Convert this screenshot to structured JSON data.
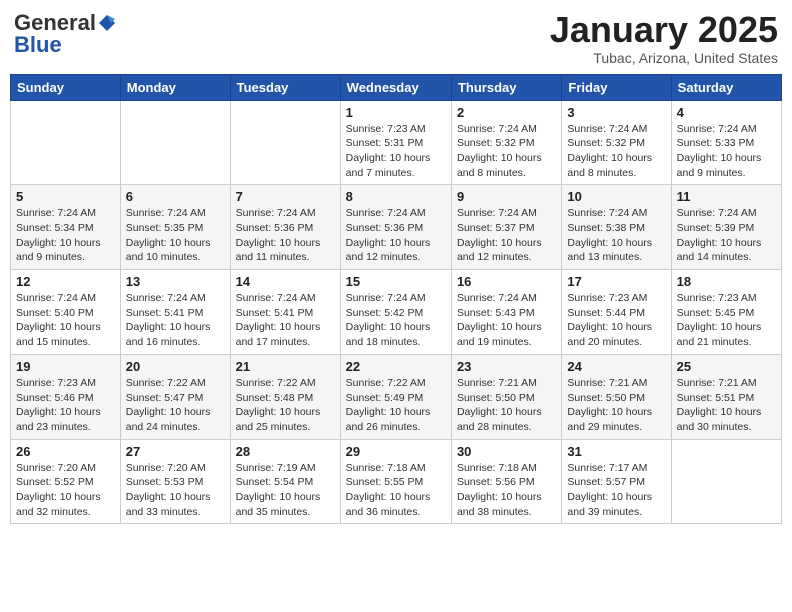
{
  "header": {
    "logo_general": "General",
    "logo_blue": "Blue",
    "title": "January 2025",
    "subtitle": "Tubac, Arizona, United States"
  },
  "weekdays": [
    "Sunday",
    "Monday",
    "Tuesday",
    "Wednesday",
    "Thursday",
    "Friday",
    "Saturday"
  ],
  "weeks": [
    [
      {
        "day": "",
        "info": ""
      },
      {
        "day": "",
        "info": ""
      },
      {
        "day": "",
        "info": ""
      },
      {
        "day": "1",
        "info": "Sunrise: 7:23 AM\nSunset: 5:31 PM\nDaylight: 10 hours\nand 7 minutes."
      },
      {
        "day": "2",
        "info": "Sunrise: 7:24 AM\nSunset: 5:32 PM\nDaylight: 10 hours\nand 8 minutes."
      },
      {
        "day": "3",
        "info": "Sunrise: 7:24 AM\nSunset: 5:32 PM\nDaylight: 10 hours\nand 8 minutes."
      },
      {
        "day": "4",
        "info": "Sunrise: 7:24 AM\nSunset: 5:33 PM\nDaylight: 10 hours\nand 9 minutes."
      }
    ],
    [
      {
        "day": "5",
        "info": "Sunrise: 7:24 AM\nSunset: 5:34 PM\nDaylight: 10 hours\nand 9 minutes."
      },
      {
        "day": "6",
        "info": "Sunrise: 7:24 AM\nSunset: 5:35 PM\nDaylight: 10 hours\nand 10 minutes."
      },
      {
        "day": "7",
        "info": "Sunrise: 7:24 AM\nSunset: 5:36 PM\nDaylight: 10 hours\nand 11 minutes."
      },
      {
        "day": "8",
        "info": "Sunrise: 7:24 AM\nSunset: 5:36 PM\nDaylight: 10 hours\nand 12 minutes."
      },
      {
        "day": "9",
        "info": "Sunrise: 7:24 AM\nSunset: 5:37 PM\nDaylight: 10 hours\nand 12 minutes."
      },
      {
        "day": "10",
        "info": "Sunrise: 7:24 AM\nSunset: 5:38 PM\nDaylight: 10 hours\nand 13 minutes."
      },
      {
        "day": "11",
        "info": "Sunrise: 7:24 AM\nSunset: 5:39 PM\nDaylight: 10 hours\nand 14 minutes."
      }
    ],
    [
      {
        "day": "12",
        "info": "Sunrise: 7:24 AM\nSunset: 5:40 PM\nDaylight: 10 hours\nand 15 minutes."
      },
      {
        "day": "13",
        "info": "Sunrise: 7:24 AM\nSunset: 5:41 PM\nDaylight: 10 hours\nand 16 minutes."
      },
      {
        "day": "14",
        "info": "Sunrise: 7:24 AM\nSunset: 5:41 PM\nDaylight: 10 hours\nand 17 minutes."
      },
      {
        "day": "15",
        "info": "Sunrise: 7:24 AM\nSunset: 5:42 PM\nDaylight: 10 hours\nand 18 minutes."
      },
      {
        "day": "16",
        "info": "Sunrise: 7:24 AM\nSunset: 5:43 PM\nDaylight: 10 hours\nand 19 minutes."
      },
      {
        "day": "17",
        "info": "Sunrise: 7:23 AM\nSunset: 5:44 PM\nDaylight: 10 hours\nand 20 minutes."
      },
      {
        "day": "18",
        "info": "Sunrise: 7:23 AM\nSunset: 5:45 PM\nDaylight: 10 hours\nand 21 minutes."
      }
    ],
    [
      {
        "day": "19",
        "info": "Sunrise: 7:23 AM\nSunset: 5:46 PM\nDaylight: 10 hours\nand 23 minutes."
      },
      {
        "day": "20",
        "info": "Sunrise: 7:22 AM\nSunset: 5:47 PM\nDaylight: 10 hours\nand 24 minutes."
      },
      {
        "day": "21",
        "info": "Sunrise: 7:22 AM\nSunset: 5:48 PM\nDaylight: 10 hours\nand 25 minutes."
      },
      {
        "day": "22",
        "info": "Sunrise: 7:22 AM\nSunset: 5:49 PM\nDaylight: 10 hours\nand 26 minutes."
      },
      {
        "day": "23",
        "info": "Sunrise: 7:21 AM\nSunset: 5:50 PM\nDaylight: 10 hours\nand 28 minutes."
      },
      {
        "day": "24",
        "info": "Sunrise: 7:21 AM\nSunset: 5:50 PM\nDaylight: 10 hours\nand 29 minutes."
      },
      {
        "day": "25",
        "info": "Sunrise: 7:21 AM\nSunset: 5:51 PM\nDaylight: 10 hours\nand 30 minutes."
      }
    ],
    [
      {
        "day": "26",
        "info": "Sunrise: 7:20 AM\nSunset: 5:52 PM\nDaylight: 10 hours\nand 32 minutes."
      },
      {
        "day": "27",
        "info": "Sunrise: 7:20 AM\nSunset: 5:53 PM\nDaylight: 10 hours\nand 33 minutes."
      },
      {
        "day": "28",
        "info": "Sunrise: 7:19 AM\nSunset: 5:54 PM\nDaylight: 10 hours\nand 35 minutes."
      },
      {
        "day": "29",
        "info": "Sunrise: 7:18 AM\nSunset: 5:55 PM\nDaylight: 10 hours\nand 36 minutes."
      },
      {
        "day": "30",
        "info": "Sunrise: 7:18 AM\nSunset: 5:56 PM\nDaylight: 10 hours\nand 38 minutes."
      },
      {
        "day": "31",
        "info": "Sunrise: 7:17 AM\nSunset: 5:57 PM\nDaylight: 10 hours\nand 39 minutes."
      },
      {
        "day": "",
        "info": ""
      }
    ]
  ]
}
